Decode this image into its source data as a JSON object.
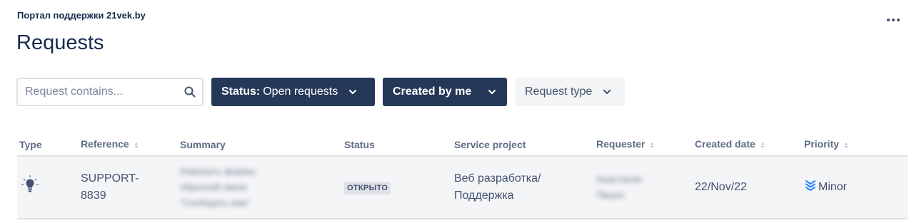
{
  "header": {
    "portal_name": "Портал поддержки 21vek.by",
    "page_title": "Requests"
  },
  "filters": {
    "search_placeholder": "Request contains...",
    "status_prefix": "Status:",
    "status_value": "Open requests",
    "created_by": "Created by me",
    "request_type": "Request type"
  },
  "table": {
    "columns": {
      "type": "Type",
      "reference": "Reference",
      "summary": "Summary",
      "status": "Status",
      "service_project": "Service project",
      "requester": "Requester",
      "created_date": "Created date",
      "priority": "Priority"
    },
    "rows": [
      {
        "type_icon": "lightbulb-icon",
        "reference_line1": "SUPPORT-",
        "reference_line2": "8839",
        "summary_line1": "Изменить формы",
        "summary_line2": "обратной связи",
        "summary_line3": "\"Сообщить нам\"",
        "status": "ОТКРЫТО",
        "service_project_line1": "Веб разработка/",
        "service_project_line2": "Поддержка",
        "requester_line1": "Анастасия",
        "requester_line2": "Пвшос",
        "created_date": "22/Nov/22",
        "priority": "Minor",
        "priority_color": "#2684ff"
      }
    ]
  },
  "colors": {
    "dark_button": "#253858",
    "text_primary": "#172b4d",
    "text_secondary": "#42526e"
  }
}
